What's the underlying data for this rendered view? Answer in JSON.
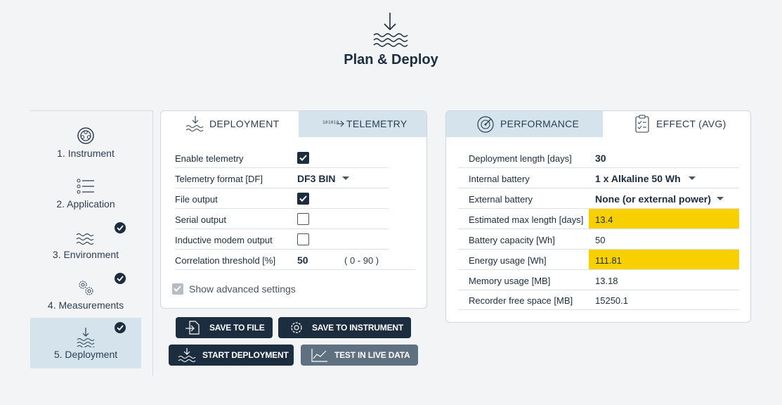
{
  "page": {
    "title": "Plan & Deploy",
    "header_icon": "deploy-waves-icon"
  },
  "sidebar": {
    "steps": [
      {
        "label": "1. Instrument",
        "icon": "instrument-icon",
        "completed": false,
        "active": false
      },
      {
        "label": "2. Application",
        "icon": "list-icon",
        "completed": false,
        "active": false
      },
      {
        "label": "3. Environment",
        "icon": "waves-icon",
        "completed": true,
        "active": false
      },
      {
        "label": "4. Measurements",
        "icon": "gears-icon",
        "completed": true,
        "active": false
      },
      {
        "label": "5. Deployment",
        "icon": "deploy-icon",
        "completed": true,
        "active": true
      }
    ]
  },
  "left_panel": {
    "tabs": [
      {
        "label": "DEPLOYMENT",
        "icon": "deploy-icon",
        "selected": false
      },
      {
        "label": "TELEMETRY",
        "icon": "telemetry-binary-icon",
        "selected": true
      }
    ],
    "rows": {
      "enable_telemetry": {
        "label": "Enable telemetry",
        "checked": true
      },
      "telemetry_format": {
        "label": "Telemetry format [DF]",
        "value": "DF3 BIN"
      },
      "file_output": {
        "label": "File output",
        "checked": true
      },
      "serial_output": {
        "label": "Serial output",
        "checked": false
      },
      "inductive_modem_output": {
        "label": "Inductive modem output",
        "checked": false
      },
      "correlation_threshold": {
        "label": "Correlation threshold [%]",
        "value": "50",
        "range": "( 0 - 90 )"
      }
    },
    "advanced": {
      "label": "Show advanced settings",
      "checked": true
    }
  },
  "buttons": {
    "save_to_file": "SAVE TO FILE",
    "save_to_instrument": "SAVE TO INSTRUMENT",
    "start_deployment": "START DEPLOYMENT",
    "test_in_live_data": "TEST IN LIVE DATA"
  },
  "right_panel": {
    "tabs": [
      {
        "label": "PERFORMANCE",
        "icon": "performance-gauge-icon",
        "selected": true
      },
      {
        "label": "EFFECT (AVG)",
        "icon": "clipboard-checklist-icon",
        "selected": false
      }
    ],
    "rows": {
      "deployment_length": {
        "label": "Deployment length [days]",
        "value": "30"
      },
      "internal_battery": {
        "label": "Internal battery",
        "value": "1 x Alkaline 50 Wh"
      },
      "external_battery": {
        "label": "External battery",
        "value": "None (or external power)"
      },
      "estimated_max_length": {
        "label": "Estimated max length [days]",
        "value": "13.4",
        "highlight": true
      },
      "battery_capacity": {
        "label": "Battery capacity [Wh]",
        "value": "50"
      },
      "energy_usage": {
        "label": "Energy usage [Wh]",
        "value": "111.81",
        "highlight": true
      },
      "memory_usage": {
        "label": "Memory usage [MB]",
        "value": "13.18"
      },
      "recorder_free_space": {
        "label": "Recorder free space [MB]",
        "value": "15250.1"
      }
    }
  },
  "colors": {
    "primary_dark": "#1b2d3f",
    "selected_tab": "#d5e3ec",
    "highlight": "#f8d000",
    "background": "#f2f4f6",
    "disabled_button": "#5f7080"
  }
}
